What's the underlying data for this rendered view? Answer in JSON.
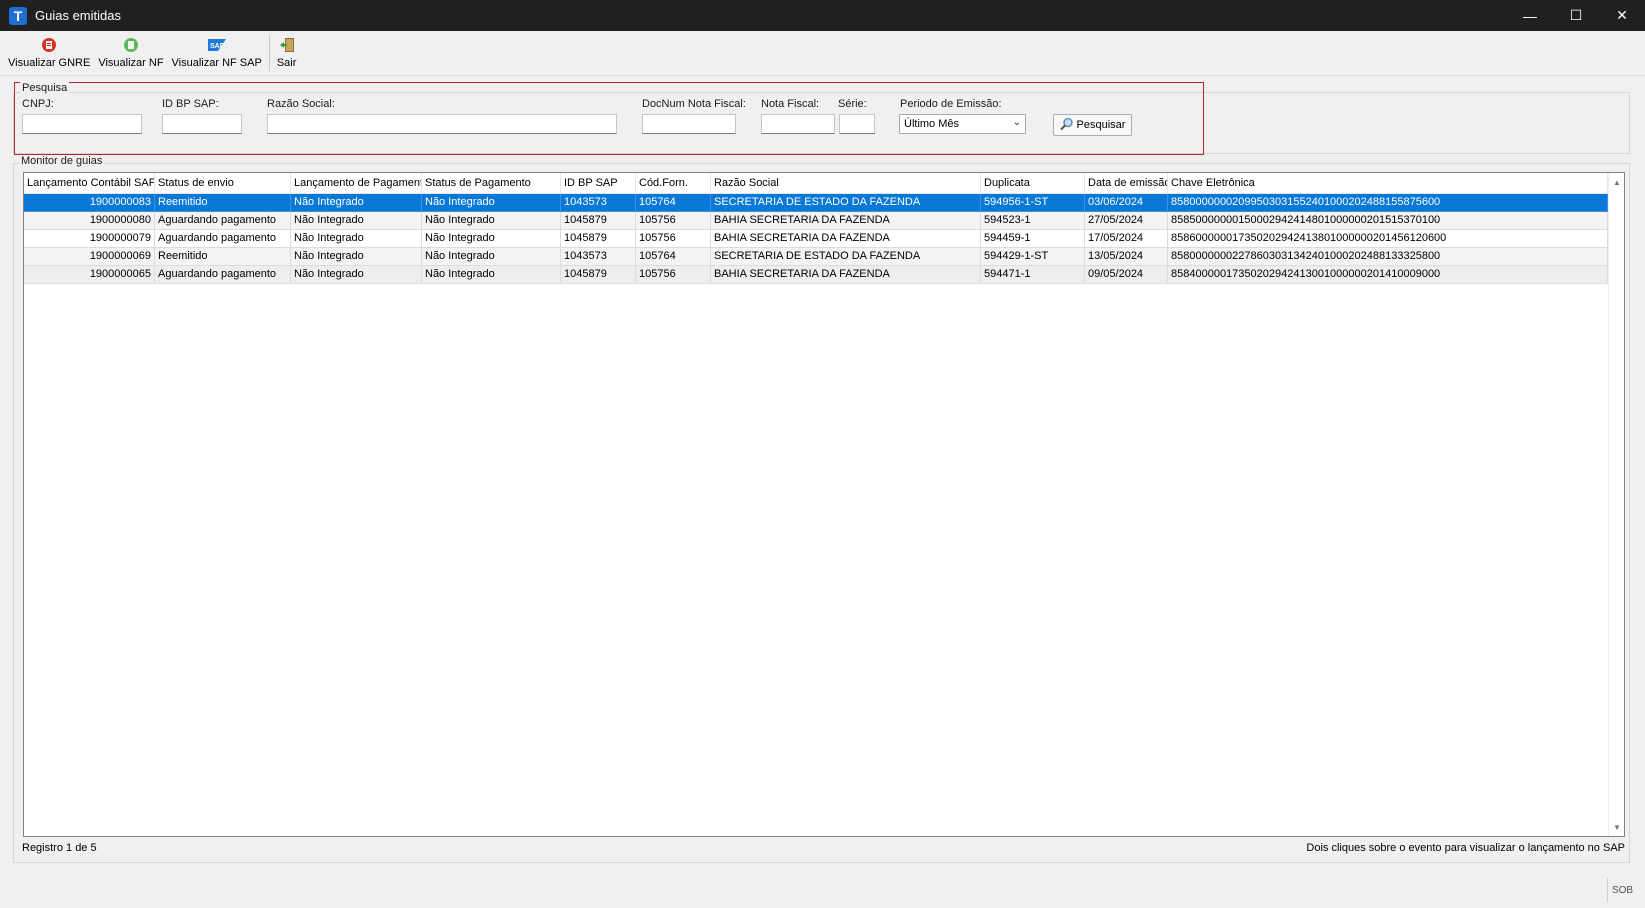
{
  "window": {
    "title": "Guias emitidas",
    "app_icon_letter": "T",
    "minimize": "—",
    "maximize": "☐",
    "close": "✕"
  },
  "toolbar": {
    "buttons": [
      {
        "label": "Visualizar GNRE",
        "icon": "red-pdf-icon"
      },
      {
        "label": "Visualizar NF",
        "icon": "green-document-icon"
      },
      {
        "label": "Visualizar NF SAP",
        "icon": "sap-logo-icon"
      },
      {
        "label": "Sair",
        "icon": "exit-door-icon"
      }
    ]
  },
  "search": {
    "group_title": "Pesquisa",
    "cnpj_label": "CNPJ:",
    "id_bp_sap_label": "ID BP SAP:",
    "razao_social_label": "Razão Social:",
    "docnum_label": "DocNum Nota Fiscal:",
    "nota_fiscal_label": "Nota Fiscal:",
    "serie_label": "Série:",
    "periodo_label": "Periodo de Emissão:",
    "periodo_value": "Último Mês",
    "search_button": "Pesquisar"
  },
  "monitor": {
    "group_title": "Monitor de guias",
    "columns": [
      "Lançamento Contábil SAP",
      "Status de envio",
      "Lançamento de Pagamento",
      "Status de Pagamento",
      "ID BP SAP",
      "Cód.Forn.",
      "Razão Social",
      "Duplicata",
      "Data de emissão",
      "Chave Eletrônica"
    ],
    "rows": [
      [
        "1900000083",
        "Reemitido",
        "Não Integrado",
        "Não Integrado",
        "1043573",
        "105764",
        "SECRETARIA DE ESTADO DA FAZENDA",
        "594956-1-ST",
        "03/06/2024",
        "85800000002099503031552401000202488155875600"
      ],
      [
        "1900000080",
        "Aguardando pagamento",
        "Não Integrado",
        "Não Integrado",
        "1045879",
        "105756",
        "BAHIA SECRETARIA DA FAZENDA",
        "594523-1",
        "27/05/2024",
        "85850000000150002942414801000000201515370100"
      ],
      [
        "1900000079",
        "Aguardando pagamento",
        "Não Integrado",
        "Não Integrado",
        "1045879",
        "105756",
        "BAHIA SECRETARIA DA FAZENDA",
        "594459-1",
        "17/05/2024",
        "85860000001735020294241380100000020145612060 0"
      ],
      [
        "1900000069",
        "Reemitido",
        "Não Integrado",
        "Não Integrado",
        "1043573",
        "105764",
        "SECRETARIA DE ESTADO DA FAZENDA",
        "594429-1-ST",
        "13/05/2024",
        "85800000002278603031342401000202488133325800"
      ],
      [
        "1900000065",
        "Aguardando pagamento",
        "Não Integrado",
        "Não Integrado",
        "1045879",
        "105756",
        "BAHIA SECRETARIA DA FAZENDA",
        "594471-1",
        "09/05/2024",
        "85840000017350202942413001000000201410009000"
      ]
    ]
  },
  "status": {
    "record_count": "Registro 1 de 5",
    "hint": "Dois cliques sobre o evento para visualizar o lançamento no SAP",
    "sob": "SOB"
  }
}
